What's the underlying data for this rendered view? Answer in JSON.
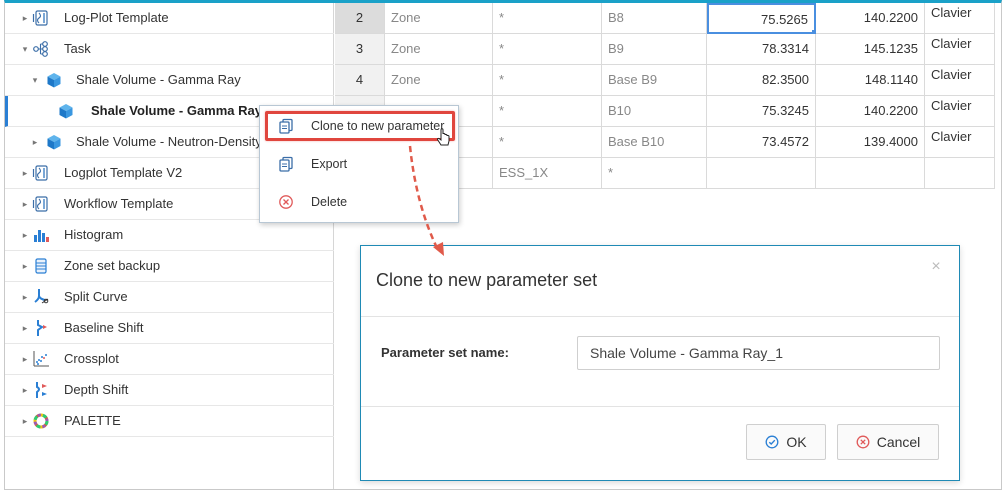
{
  "tree": {
    "items": [
      {
        "label": "Log-Plot Template",
        "icon": "log-plot-icon",
        "caret": "collapsed"
      },
      {
        "label": "Task",
        "icon": "task-icon",
        "caret": "expanded"
      },
      {
        "label": "Shale Volume - Gamma Ray",
        "icon": "cube-icon",
        "caret": "expanded"
      },
      {
        "label": "Shale Volume - Gamma Ray",
        "icon": "cube-icon",
        "caret": "none",
        "selected": true
      },
      {
        "label": "Shale Volume - Neutron-Density",
        "icon": "cube-icon",
        "caret": "collapsed"
      },
      {
        "label": "Logplot Template V2",
        "icon": "log-plot-icon",
        "caret": "collapsed"
      },
      {
        "label": "Workflow Template",
        "icon": "log-plot-icon",
        "caret": "collapsed"
      },
      {
        "label": "Histogram",
        "icon": "histogram-icon",
        "caret": "collapsed"
      },
      {
        "label": "Zone set backup",
        "icon": "zone-set-icon",
        "caret": "collapsed"
      },
      {
        "label": "Split Curve",
        "icon": "split-curve-icon",
        "caret": "collapsed"
      },
      {
        "label": "Baseline Shift",
        "icon": "baseline-shift-icon",
        "caret": "collapsed"
      },
      {
        "label": "Crossplot",
        "icon": "crossplot-icon",
        "caret": "collapsed"
      },
      {
        "label": "Depth Shift",
        "icon": "depth-shift-icon",
        "caret": "collapsed"
      },
      {
        "label": "PALETTE",
        "icon": "palette-icon",
        "caret": "collapsed"
      }
    ]
  },
  "grid": {
    "rows": [
      {
        "num": "2",
        "type": "Zone",
        "star": "*",
        "name": "B8",
        "v1": "75.5265",
        "v2": "140.2200",
        "owner": "Clavier"
      },
      {
        "num": "3",
        "type": "Zone",
        "star": "*",
        "name": "B9",
        "v1": "78.3314",
        "v2": "145.1235",
        "owner": "Clavier"
      },
      {
        "num": "4",
        "type": "Zone",
        "star": "*",
        "name": "Base B9",
        "v1": "82.3500",
        "v2": "148.1140",
        "owner": "Clavier"
      },
      {
        "num": "",
        "type": "",
        "star": "*",
        "name": "B10",
        "v1": "75.3245",
        "v2": "140.2200",
        "owner": "Clavier"
      },
      {
        "num": "",
        "type": "",
        "star": "*",
        "name": "Base B10",
        "v1": "73.4572",
        "v2": "139.4000",
        "owner": "Clavier"
      },
      {
        "num": "",
        "type": "",
        "star": "ESS_1X",
        "name": "*",
        "v1": "",
        "v2": "",
        "owner": ""
      }
    ]
  },
  "context_menu": {
    "items": [
      {
        "label": "Clone to new parameter",
        "icon": "copy-icon"
      },
      {
        "label": "Export",
        "icon": "export-icon"
      },
      {
        "label": "Delete",
        "icon": "delete-icon"
      }
    ]
  },
  "dialog": {
    "title": "Clone to new parameter set",
    "field_label": "Parameter set name:",
    "field_value": "Shale Volume - Gamma Ray_1",
    "ok_label": "OK",
    "cancel_label": "Cancel"
  },
  "colors": {
    "accent": "#1aa1c8",
    "highlight": "#e0463e",
    "selection": "#4a8fe0"
  }
}
